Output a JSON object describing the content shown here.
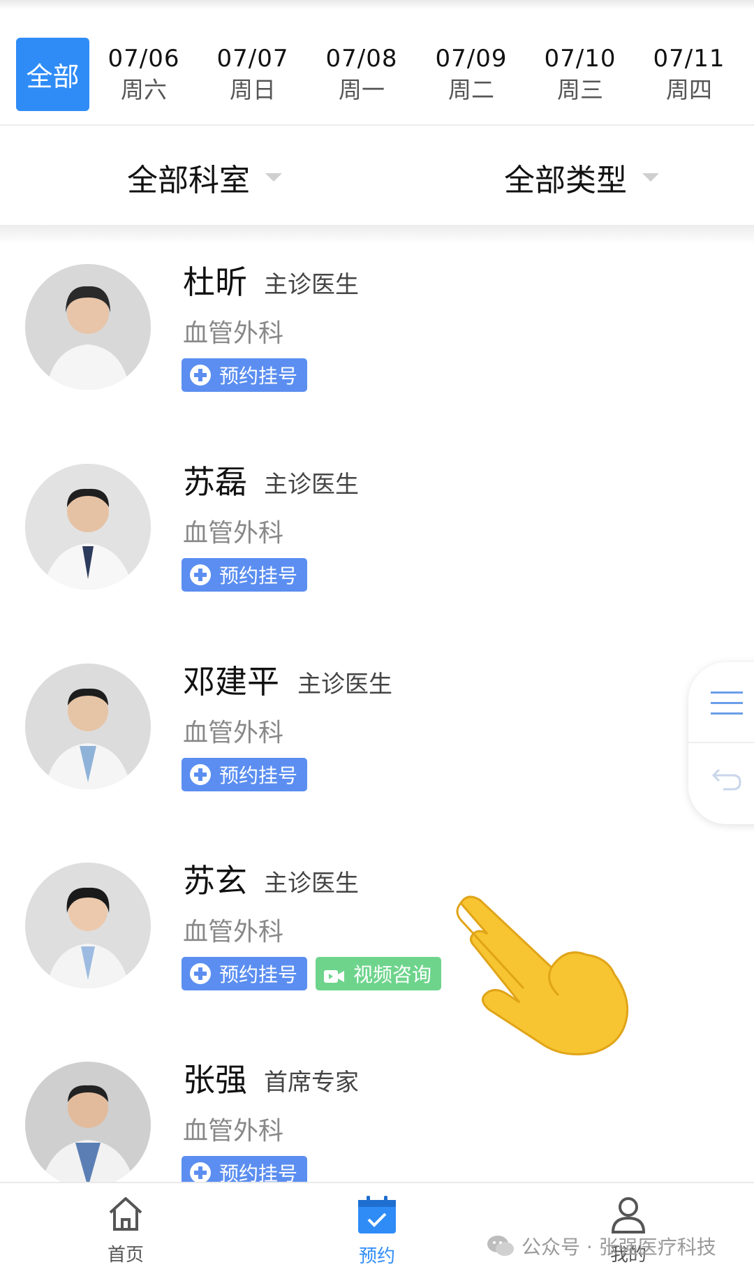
{
  "dates": {
    "all_label": "全部",
    "items": [
      {
        "date": "07/06",
        "weekday": "周六"
      },
      {
        "date": "07/07",
        "weekday": "周日"
      },
      {
        "date": "07/08",
        "weekday": "周一"
      },
      {
        "date": "07/09",
        "weekday": "周二"
      },
      {
        "date": "07/10",
        "weekday": "周三"
      },
      {
        "date": "07/11",
        "weekday": "周四"
      }
    ]
  },
  "filters": {
    "department": "全部科室",
    "type": "全部类型"
  },
  "doctors": [
    {
      "name": "杜昕",
      "title": "主诊医生",
      "dept": "血管外科",
      "book": "预约挂号"
    },
    {
      "name": "苏磊",
      "title": "主诊医生",
      "dept": "血管外科",
      "book": "预约挂号"
    },
    {
      "name": "邓建平",
      "title": "主诊医生",
      "dept": "血管外科",
      "book": "预约挂号"
    },
    {
      "name": "苏玄",
      "title": "主诊医生",
      "dept": "血管外科",
      "book": "预约挂号",
      "video": "视频咨询"
    },
    {
      "name": "张强",
      "title": "首席专家",
      "dept": "血管外科",
      "book": "预约挂号"
    }
  ],
  "nav": {
    "home": "首页",
    "booking": "预约",
    "mine": "我的"
  },
  "watermark": "公众号 · 张强医疗科技",
  "colors": {
    "accent": "#2f8cf7",
    "book_button": "#5b8ef0",
    "video_button": "#6ed48c"
  }
}
